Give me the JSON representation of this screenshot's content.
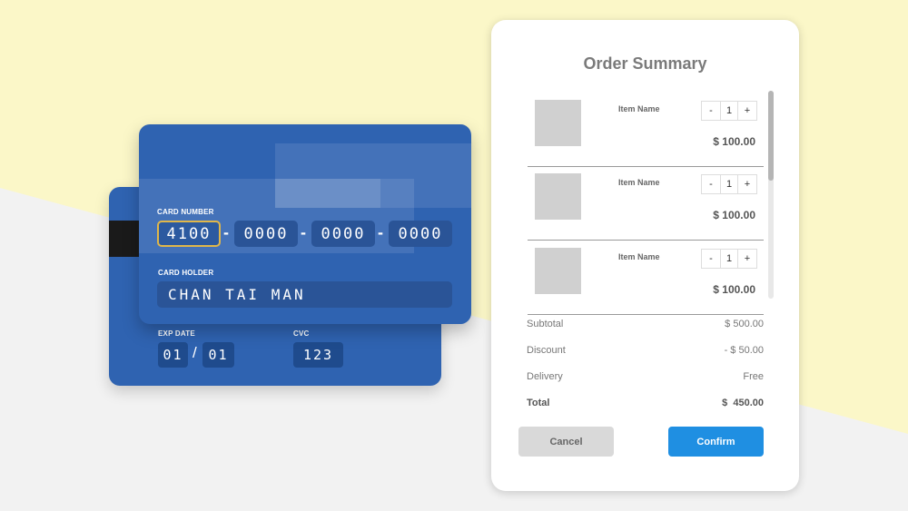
{
  "colors": {
    "background_top": "#fbf7c8",
    "background_bottom": "#f2f2f2",
    "card_blue": "#2f63b1",
    "card_field": "#2a5497",
    "active_outline": "#e0b74a",
    "confirm": "#1f8fe2",
    "cancel": "#d9d9d9"
  },
  "card_back": {
    "exp_label": "EXP DATE",
    "exp_month": "01",
    "exp_separator": "/",
    "exp_year": "01",
    "cvc_label": "CVC",
    "cvc_value": "123"
  },
  "card_front": {
    "number_label": "CARD NUMBER",
    "number_groups": [
      "4100",
      "0000",
      "0000",
      "0000"
    ],
    "group_separator": "-",
    "holder_label": "CARD HOLDER",
    "holder_name": "CHAN TAI MAN"
  },
  "order": {
    "title": "Order Summary",
    "items": [
      {
        "name": "Item Name",
        "quantity": "1",
        "price": "$ 100.00",
        "minus": "-",
        "plus": "+"
      },
      {
        "name": "Item Name",
        "quantity": "1",
        "price": "$ 100.00",
        "minus": "-",
        "plus": "+"
      },
      {
        "name": "Item Name",
        "quantity": "1",
        "price": "$ 100.00",
        "minus": "-",
        "plus": "+"
      }
    ],
    "summary": {
      "subtotal_label": "Subtotal",
      "subtotal_value": "$ 500.00",
      "discount_label": "Discount",
      "discount_value": "- $ 50.00",
      "delivery_label": "Delivery",
      "delivery_value": "Free",
      "total_label": "Total",
      "total_value": "$  450.00"
    },
    "cancel_label": "Cancel",
    "confirm_label": "Confirm"
  }
}
